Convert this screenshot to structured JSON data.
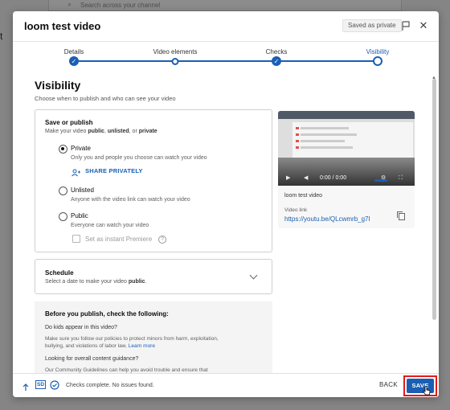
{
  "background": {
    "search_placeholder": "Search across your channel"
  },
  "dialog": {
    "title": "loom test video",
    "saved_badge": "Saved as private",
    "steps": [
      {
        "label": "Details",
        "state": "done"
      },
      {
        "label": "Video elements",
        "state": "done"
      },
      {
        "label": "Checks",
        "state": "done"
      },
      {
        "label": "Visibility",
        "state": "active"
      }
    ]
  },
  "visibility": {
    "title": "Visibility",
    "subtitle": "Choose when to publish and who can see your video",
    "save_publish": {
      "title": "Save or publish",
      "subtitle_prefix": "Make your video ",
      "subtitle_opt1": "public",
      "subtitle_sep1": ", ",
      "subtitle_opt2": "unlisted",
      "subtitle_sep2": ", or ",
      "subtitle_opt3": "private",
      "options": [
        {
          "label": "Private",
          "desc": "Only you and people you choose can watch your video",
          "selected": true
        },
        {
          "label": "Unlisted",
          "desc": "Anyone with the video link can watch your video",
          "selected": false
        },
        {
          "label": "Public",
          "desc": "Everyone can watch your video",
          "selected": false
        }
      ],
      "share_privately": "SHARE PRIVATELY",
      "premiere_label": "Set as instant Premiere",
      "premiere_checked": false
    },
    "schedule": {
      "title": "Schedule",
      "subtitle_prefix": "Select a date to make your video ",
      "subtitle_bold": "public",
      "subtitle_suffix": "."
    },
    "checklist": {
      "title": "Before you publish, check the following:",
      "q1": "Do kids appear in this video?",
      "a1_line1": "Make sure you follow our policies to protect minors from harm, exploitation,",
      "a1_line2": "bullying, and violations of labor law.",
      "a1_link": "Learn more",
      "q2": "Looking for overall content guidance?",
      "a2_line1": "Our Community Guidelines can help you avoid trouble and ensure that"
    }
  },
  "preview": {
    "time": "0:00 / 0:00",
    "video_name": "loom test video",
    "link_label": "Video link",
    "link": "https://youtu.be/QLcwmrb_g7I"
  },
  "footer": {
    "sd_badge": "SD",
    "status": "Checks complete. No issues found.",
    "back": "BACK",
    "save": "SAVE"
  },
  "colors": {
    "accent": "#1a5fb4",
    "highlight": "#e21b1b"
  }
}
